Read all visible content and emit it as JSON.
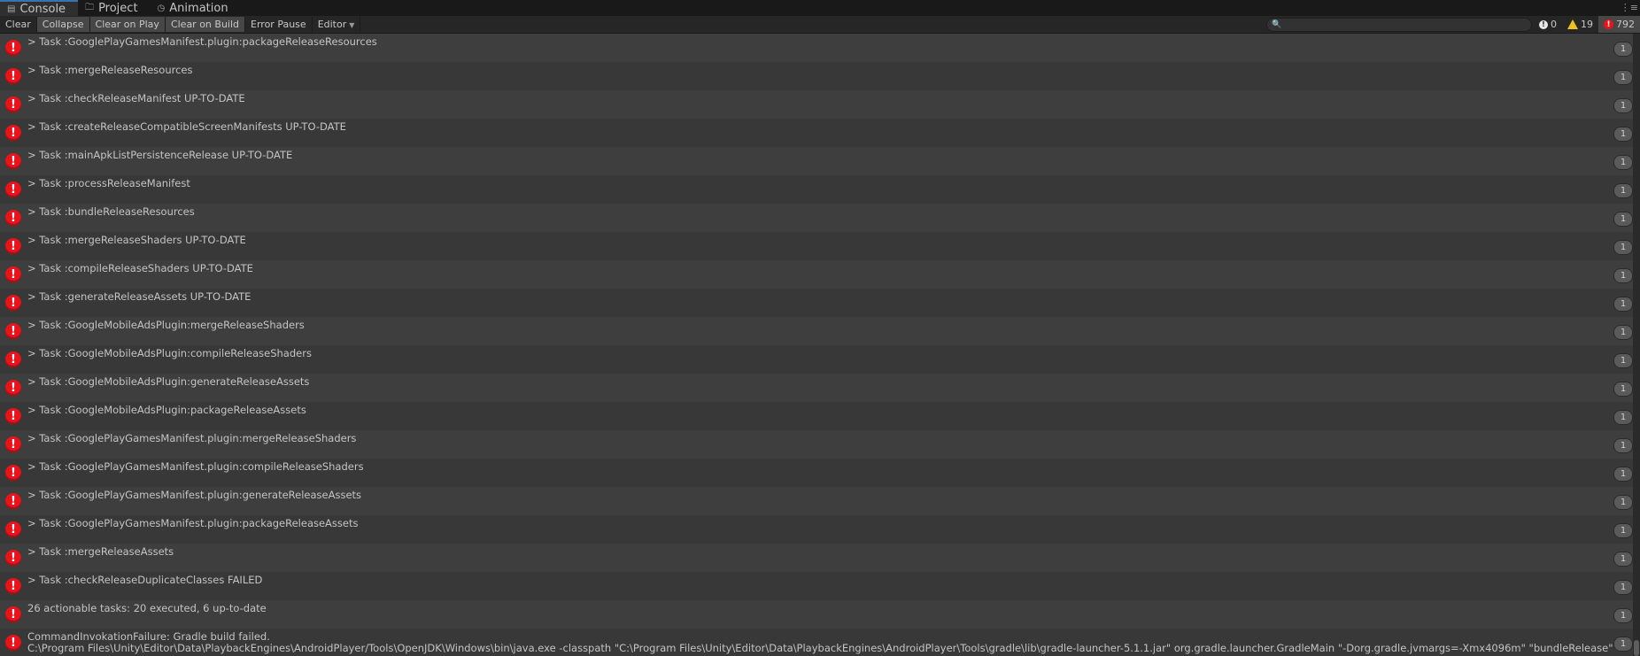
{
  "tabs": [
    {
      "label": "Console",
      "icon": "console-icon"
    },
    {
      "label": "Project",
      "icon": "folder-icon"
    },
    {
      "label": "Animation",
      "icon": "clock-icon"
    }
  ],
  "toolbar": {
    "clear": "Clear",
    "collapse": "Collapse",
    "clear_on_play": "Clear on Play",
    "clear_on_build": "Clear on Build",
    "error_pause": "Error Pause",
    "editor": "Editor",
    "search_placeholder": ""
  },
  "counts": {
    "info": "0",
    "warnings": "19",
    "errors": "792"
  },
  "entries": [
    {
      "text": "> Task :GooglePlayGamesManifest.plugin:packageReleaseResources",
      "count": "1"
    },
    {
      "text": "> Task :mergeReleaseResources",
      "count": "1"
    },
    {
      "text": "> Task :checkReleaseManifest UP-TO-DATE",
      "count": "1"
    },
    {
      "text": "> Task :createReleaseCompatibleScreenManifests UP-TO-DATE",
      "count": "1"
    },
    {
      "text": "> Task :mainApkListPersistenceRelease UP-TO-DATE",
      "count": "1"
    },
    {
      "text": "> Task :processReleaseManifest",
      "count": "1"
    },
    {
      "text": "> Task :bundleReleaseResources",
      "count": "1"
    },
    {
      "text": "> Task :mergeReleaseShaders UP-TO-DATE",
      "count": "1"
    },
    {
      "text": "> Task :compileReleaseShaders UP-TO-DATE",
      "count": "1"
    },
    {
      "text": "> Task :generateReleaseAssets UP-TO-DATE",
      "count": "1"
    },
    {
      "text": "> Task :GoogleMobileAdsPlugin:mergeReleaseShaders",
      "count": "1"
    },
    {
      "text": "> Task :GoogleMobileAdsPlugin:compileReleaseShaders",
      "count": "1"
    },
    {
      "text": "> Task :GoogleMobileAdsPlugin:generateReleaseAssets",
      "count": "1"
    },
    {
      "text": "> Task :GoogleMobileAdsPlugin:packageReleaseAssets",
      "count": "1"
    },
    {
      "text": "> Task :GooglePlayGamesManifest.plugin:mergeReleaseShaders",
      "count": "1"
    },
    {
      "text": "> Task :GooglePlayGamesManifest.plugin:compileReleaseShaders",
      "count": "1"
    },
    {
      "text": "> Task :GooglePlayGamesManifest.plugin:generateReleaseAssets",
      "count": "1"
    },
    {
      "text": "> Task :GooglePlayGamesManifest.plugin:packageReleaseAssets",
      "count": "1"
    },
    {
      "text": "> Task :mergeReleaseAssets",
      "count": "1"
    },
    {
      "text": "> Task :checkReleaseDuplicateClasses FAILED",
      "count": "1"
    },
    {
      "text": "26 actionable tasks: 20 executed, 6 up-to-date",
      "count": "1"
    },
    {
      "text": "CommandInvokationFailure: Gradle build failed.\nC:\\Program Files\\Unity\\Editor\\Data\\PlaybackEngines\\AndroidPlayer/Tools\\OpenJDK\\Windows\\bin\\java.exe -classpath \"C:\\Program Files\\Unity\\Editor\\Data\\PlaybackEngines\\AndroidPlayer\\Tools\\gradle\\lib\\gradle-launcher-5.1.1.jar\" org.gradle.launcher.GradleMain \"-Dorg.gradle.jvmargs=-Xmx4096m\" \"bundleRelease\"",
      "count": "1"
    }
  ]
}
